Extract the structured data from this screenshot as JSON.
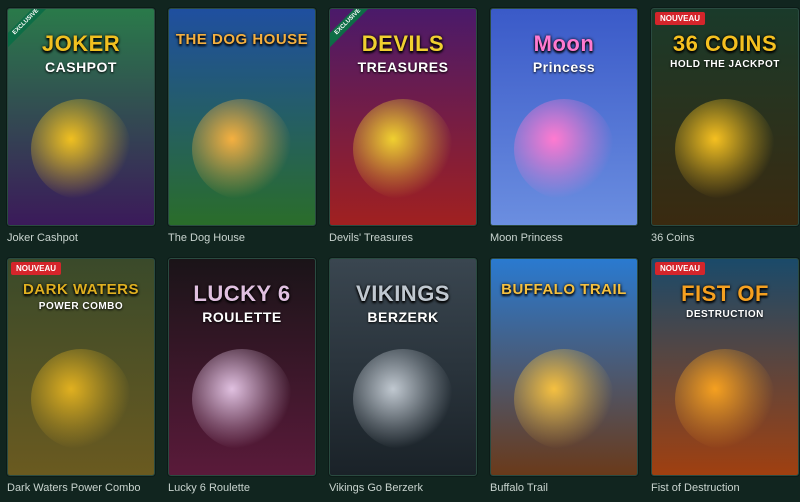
{
  "games": [
    {
      "title": "Joker Cashpot",
      "logo": "JOKER",
      "logo_sub": "CASHPOT",
      "badge": "EXCLUSIVE",
      "badge_type": "ribbon",
      "bg1": "#2a7a4a",
      "bg2": "#3b1a5a",
      "accent": "#f0c020"
    },
    {
      "title": "The Dog House",
      "logo": "THE DOG HOUSE",
      "logo_sub": "",
      "badge": "",
      "badge_type": "",
      "bg1": "#1f4fa0",
      "bg2": "#2a6d2a",
      "accent": "#f5b040"
    },
    {
      "title": "Devils' Treasures",
      "logo": "DEVILS",
      "logo_sub": "TREASURES",
      "badge": "EXCLUSIVE",
      "badge_type": "ribbon",
      "bg1": "#4a1a6a",
      "bg2": "#a02020",
      "accent": "#f0d030"
    },
    {
      "title": "Moon Princess",
      "logo": "Moon",
      "logo_sub": "Princess",
      "badge": "",
      "badge_type": "",
      "bg1": "#3a5ac8",
      "bg2": "#6b8ee0",
      "accent": "#ff7ad0"
    },
    {
      "title": "36 Coins",
      "logo": "36 COINS",
      "logo_sub": "HOLD THE JACKPOT",
      "badge": "NOUVEAU",
      "badge_type": "new",
      "bg1": "#1a3a2a",
      "bg2": "#3a2a10",
      "accent": "#f5c020"
    },
    {
      "title": "Dark Waters Power Combo",
      "logo": "DARK WATERS",
      "logo_sub": "POWER COMBO",
      "badge": "NOUVEAU",
      "badge_type": "new",
      "bg1": "#3a4a2a",
      "bg2": "#6a5a20",
      "accent": "#e0b020"
    },
    {
      "title": "Lucky 6 Roulette",
      "logo": "LUCKY 6",
      "logo_sub": "ROULETTE",
      "badge": "",
      "badge_type": "",
      "bg1": "#1a1418",
      "bg2": "#5a1a3a",
      "accent": "#e0c0e0"
    },
    {
      "title": "Vikings Go Berzerk",
      "logo": "VIKINGS",
      "logo_sub": "BERZERK",
      "badge": "",
      "badge_type": "",
      "bg1": "#3a4650",
      "bg2": "#1a2228",
      "accent": "#c0c8d0"
    },
    {
      "title": "Buffalo Trail",
      "logo": "BUFFALO TRAIL",
      "logo_sub": "",
      "badge": "",
      "badge_type": "",
      "bg1": "#2a7ad0",
      "bg2": "#6a3a1a",
      "accent": "#f5c040"
    },
    {
      "title": "Fist of Destruction",
      "logo": "FIST OF",
      "logo_sub": "DESTRUCTION",
      "badge": "NOUVEAU",
      "badge_type": "new",
      "bg1": "#1a4a6a",
      "bg2": "#a04010",
      "accent": "#f5a020"
    }
  ]
}
